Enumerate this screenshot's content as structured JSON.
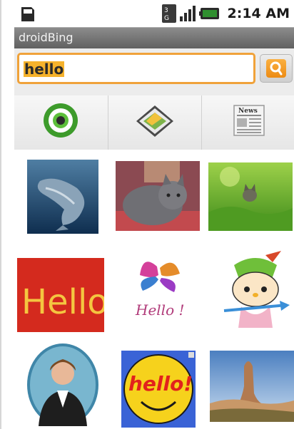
{
  "status_bar": {
    "time": "2:14 AM",
    "icons": [
      "sd-card-icon",
      "3g-icon",
      "signal-icon",
      "battery-icon"
    ]
  },
  "app": {
    "title": "droidBing"
  },
  "search": {
    "query": "hello",
    "button_icon": "search-icon",
    "accent_color": "#f0a23a"
  },
  "tabs": [
    {
      "name": "web",
      "icon": "web-target-icon"
    },
    {
      "name": "images",
      "icon": "image-icon"
    },
    {
      "name": "news",
      "icon": "newspaper-icon",
      "label": "News"
    }
  ],
  "results": {
    "images": [
      {
        "subject": "dolphin"
      },
      {
        "subject": "gray-cat"
      },
      {
        "subject": "kitten-in-grass"
      },
      {
        "subject": "hello-red-knit",
        "text": "Hello"
      },
      {
        "subject": "hello-butterfly-script",
        "text": "Hello !"
      },
      {
        "subject": "hello-kitty-archer"
      },
      {
        "subject": "portrait-man"
      },
      {
        "subject": "hello-yellow-smiley",
        "text": "hello!"
      },
      {
        "subject": "rock-formation"
      }
    ]
  }
}
